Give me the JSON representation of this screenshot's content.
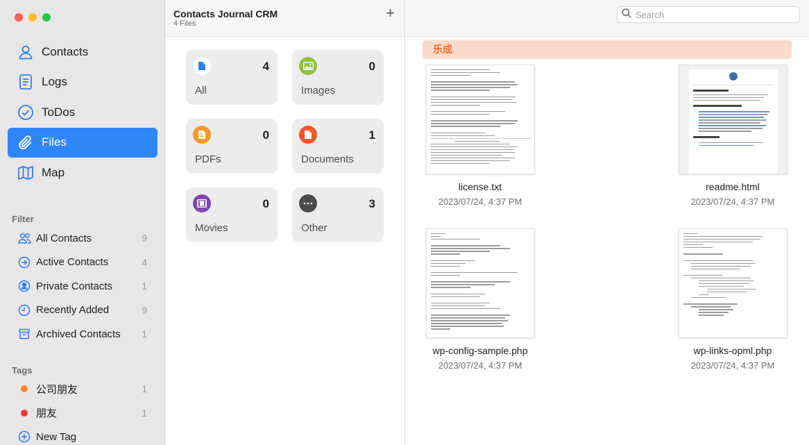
{
  "sidebar": {
    "nav": [
      {
        "label": "Contacts",
        "icon": "person-icon",
        "active": false
      },
      {
        "label": "Logs",
        "icon": "document-icon",
        "active": false
      },
      {
        "label": "ToDos",
        "icon": "checkmark-circle-icon",
        "active": false
      },
      {
        "label": "Files",
        "icon": "paperclip-icon",
        "active": true
      },
      {
        "label": "Map",
        "icon": "map-icon",
        "active": false
      }
    ],
    "filter_title": "Filter",
    "filters": [
      {
        "label": "All Contacts",
        "count": "9",
        "icon": "people-icon"
      },
      {
        "label": "Active Contacts",
        "count": "4",
        "icon": "arrow-circle-icon"
      },
      {
        "label": "Private Contacts",
        "count": "1",
        "icon": "person-circle-icon"
      },
      {
        "label": "Recently Added",
        "count": "9",
        "icon": "clock-icon"
      },
      {
        "label": "Archived Contacts",
        "count": "1",
        "icon": "archive-box-icon"
      }
    ],
    "tags_title": "Tags",
    "tags": [
      {
        "label": "公司朋友",
        "count": "1",
        "color": "#f7892b"
      },
      {
        "label": "朋友",
        "count": "1",
        "color": "#f03a32"
      }
    ],
    "new_tag_label": "New Tag"
  },
  "middle": {
    "title": "Contacts Journal CRM",
    "subtitle": "4 Files",
    "categories": [
      {
        "label": "All",
        "count": "4",
        "color": "#2f7ef0",
        "icon": "document-icon"
      },
      {
        "label": "Images",
        "count": "0",
        "color": "#8fc23a",
        "icon": "image-icon"
      },
      {
        "label": "PDFs",
        "count": "0",
        "color": "#f29a2e",
        "icon": "pdf-icon"
      },
      {
        "label": "Documents",
        "count": "1",
        "color": "#f0552c",
        "icon": "document-icon"
      },
      {
        "label": "Movies",
        "count": "0",
        "color": "#7b47b3",
        "icon": "film-icon"
      },
      {
        "label": "Other",
        "count": "3",
        "color": "#4b4b4d",
        "icon": "ellipsis-icon"
      }
    ]
  },
  "right": {
    "search_placeholder": "Search",
    "group_title": "乐成",
    "files": [
      {
        "name": "license.txt",
        "date": "2023/07/24, 4:37 PM"
      },
      {
        "name": "readme.html",
        "date": "2023/07/24, 4:37 PM"
      },
      {
        "name": "wp-config-sample.php",
        "date": "2023/07/24, 4:37 PM"
      },
      {
        "name": "wp-links-opml.php",
        "date": "2023/07/24, 4:37 PM"
      }
    ]
  },
  "colors": {
    "accent": "#2f86f6",
    "group_banner_bg": "#fbdacb",
    "group_banner_text": "#f26a2b"
  }
}
